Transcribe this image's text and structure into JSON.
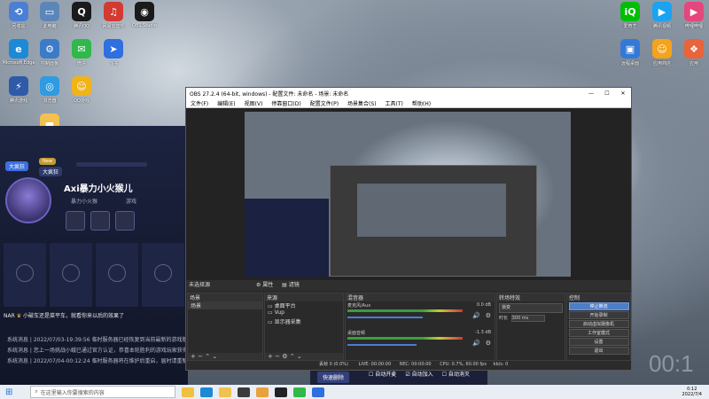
{
  "desktop": {
    "icons_left": [
      {
        "name": "recycle-bin-icon",
        "label": "回收站",
        "color": "#4a7fd4",
        "glyph": "⟲"
      },
      {
        "name": "computer-icon",
        "label": "此电脑",
        "color": "#5c86b8",
        "glyph": "▭"
      },
      {
        "name": "qq-icon",
        "label": "腾讯QQ",
        "color": "#1a1a1a",
        "glyph": "Q"
      },
      {
        "name": "netease-music-icon",
        "label": "网易云音乐",
        "color": "#d33a31",
        "glyph": "♫"
      },
      {
        "name": "obs-icon",
        "label": "OBS Studio",
        "color": "#1a1a1a",
        "glyph": "◉"
      },
      {
        "name": "edge-icon",
        "label": "Microsoft Edge",
        "color": "#1c8ad6",
        "glyph": "e"
      },
      {
        "name": "control-panel-icon",
        "label": "控制面板",
        "color": "#3b7bc8",
        "glyph": "⚙"
      },
      {
        "name": "wechat-icon",
        "label": "微信",
        "color": "#2fb94a",
        "glyph": "✉"
      },
      {
        "name": "feishu-icon",
        "label": "飞书",
        "color": "#2f6fe0",
        "glyph": "➤"
      },
      {
        "name": "game-launcher-icon",
        "label": "腾讯游戏",
        "color": "#2e5aa8",
        "glyph": "⚡"
      },
      {
        "name": "browser-icon",
        "label": "浏览器",
        "color": "#2f9be0",
        "glyph": "◎"
      },
      {
        "name": "qq-game-icon",
        "label": "QQ游戏",
        "color": "#f0b419",
        "glyph": "☺"
      },
      {
        "name": "folder-icon",
        "label": "",
        "color": "#f2c14e",
        "glyph": "▬"
      }
    ],
    "icons_right": [
      {
        "name": "iqiyi-icon",
        "label": "爱奇艺",
        "color": "#00be06",
        "glyph": "iQ"
      },
      {
        "name": "tencent-video-icon",
        "label": "腾讯视频",
        "color": "#1aa3f0",
        "glyph": "▶"
      },
      {
        "name": "bilibili-icon",
        "label": "哔哩哔哩",
        "color": "#e5467c",
        "glyph": "▶"
      },
      {
        "name": "remote-desktop-icon",
        "label": "远程桌面",
        "color": "#3479d6",
        "glyph": "▣"
      },
      {
        "name": "app-store-icon",
        "label": "应用商店",
        "color": "#f4a31c",
        "glyph": "☺"
      },
      {
        "name": "app-icon",
        "label": "应用",
        "color": "#e9633b",
        "glyph": "❖"
      }
    ]
  },
  "game_panel": {
    "tag1": "大疯狂",
    "tag2": "New",
    "tag3": "大疯狂",
    "player_name": "Axi暴力小火猴儿",
    "sub1": "暴力小火猴",
    "sub2": "游戏",
    "ticker_user": "NAR",
    "ticker_text": "小破车还是菜平车，就看你来以后的效果了",
    "logs": [
      "系统消息 | 2022/07/03-19:39:56 临时服务器已经恢复到当前最新的游戏版本，点击前往",
      "系统消息 | 您上一场挑战小蛾已通过官方认证，恭喜本轮胜利的游戏玩家获得奖励",
      "系统消息 | 2022/07/04-00:12:24 临时服务器将在维护后重启，届时请重新登录，谢谢"
    ]
  },
  "obs": {
    "title": "OBS 27.2.4 (64-bit, windows) - 配置文件: 未命名 - 场景: 未命名",
    "menu": [
      "文件(F)",
      "编辑(E)",
      "视图(V)",
      "停靠窗口(D)",
      "配置文件(P)",
      "场景集合(S)",
      "工具(T)",
      "帮助(H)"
    ],
    "source_bar": {
      "no_source": "未选择源",
      "properties": "属性",
      "filters": "滤镜"
    },
    "docks": {
      "scenes": {
        "title": "场景",
        "items": [
          "场景"
        ]
      },
      "sources": {
        "title": "来源",
        "items": [
          "桌面平台",
          "Vup",
          "显示器采集"
        ]
      },
      "mixer": {
        "title": "混音器",
        "channels": [
          {
            "name": "麦克风/Aux",
            "db": "0.0 dB",
            "level": 0.65
          },
          {
            "name": "桌面音频",
            "db": "-1.3 dB",
            "level": 0.6
          }
        ]
      },
      "transitions": {
        "title": "转场特效",
        "type": "渐变",
        "duration_label": "时长",
        "duration": "300 ms"
      },
      "controls": {
        "title": "控制",
        "buttons": [
          "停止推流",
          "开始录制",
          "启动虚拟摄像机",
          "工作室模式",
          "设置",
          "退出"
        ],
        "active": 0
      }
    },
    "statusbar": {
      "drop": "丢帧 0 (0.0%)",
      "live": "LIVE: 00:00:00",
      "rec": "REC: 00:00:00",
      "cpu": "CPU: 0.7%, 60.00 fps",
      "kbps": "kb/s: 0"
    }
  },
  "bottom_tabs": [
    "快速删除",
    "自动开麦",
    "自动加入",
    "自动消灭"
  ],
  "taskbar": {
    "search_placeholder": "在这里输入你要搜索的内容",
    "time": "0:12",
    "date": "2022/7/4",
    "big_clock": "00:1"
  }
}
